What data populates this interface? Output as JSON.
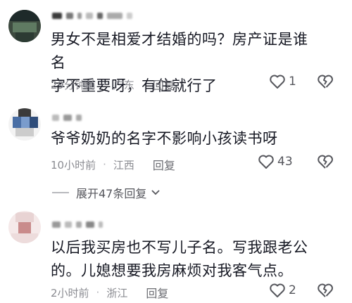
{
  "comments": [
    {
      "text_line1": "男女不是相爱才结婚的吗？房产证是谁名",
      "text_line2": "字不重要呀，有住就行了",
      "time": "29分钟前",
      "location": "广东",
      "reply": "回复",
      "likes": "1"
    },
    {
      "text_line1": "爷爷奶奶的名字不影响小孩读书呀",
      "time": "10小时前",
      "location": "江西",
      "reply": "回复",
      "likes": "43"
    },
    {
      "text_line1": "以后我买房也不写儿子名。写我跟老公",
      "text_line2": "的。儿媳想要我房麻烦对我客气点。",
      "time": "2小时前",
      "location": "浙江",
      "reply": "回复",
      "likes": "2"
    }
  ],
  "expand_replies": "展开47条回复",
  "meta_separator": "·",
  "icons": {
    "like": "heart-outline-icon",
    "dislike": "broken-heart-icon",
    "expand": "chevron-down-icon"
  },
  "colors": {
    "text": "#161823",
    "meta": "#8a8b91",
    "icon": "#55565c"
  }
}
